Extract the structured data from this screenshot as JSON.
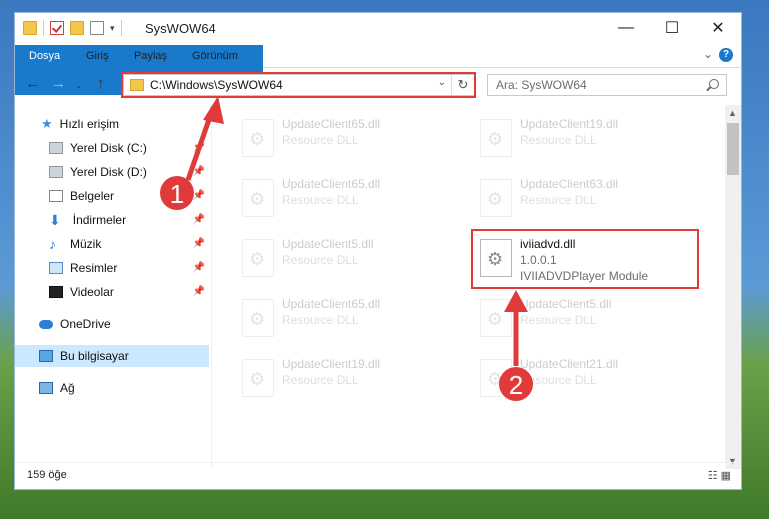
{
  "window": {
    "title": "SysWOW64",
    "controls": {
      "minimize": "—",
      "maximize": "☐",
      "close": "✕"
    }
  },
  "ribbon": {
    "tabs": [
      "Dosya",
      "Giriş",
      "Paylaş",
      "Görünüm"
    ],
    "help": "?"
  },
  "address_bar": {
    "path": "C:\\Windows\\SysWOW64",
    "refresh_glyph": "↻"
  },
  "search": {
    "placeholder": "Ara: SysWOW64"
  },
  "sidebar": {
    "items": [
      {
        "label": "Hızlı erişim",
        "icon": "star-icon"
      },
      {
        "label": "Yerel Disk (C:)",
        "icon": "disk-icon",
        "pinned": true
      },
      {
        "label": "Yerel Disk (D:)",
        "icon": "disk-icon",
        "pinned": true
      },
      {
        "label": "Belgeler",
        "icon": "document-icon",
        "pinned": true
      },
      {
        "label": "İndirmeler",
        "icon": "download-icon",
        "pinned": true
      },
      {
        "label": "Müzik",
        "icon": "music-icon",
        "pinned": true
      },
      {
        "label": "Resimler",
        "icon": "picture-icon",
        "pinned": true
      },
      {
        "label": "Videolar",
        "icon": "video-icon",
        "pinned": true
      },
      {
        "label": "OneDrive",
        "icon": "cloud-icon"
      },
      {
        "label": "Bu bilgisayar",
        "icon": "computer-icon",
        "selected": true
      },
      {
        "label": "Ağ",
        "icon": "network-icon"
      }
    ]
  },
  "files": [
    {
      "name": "UpdateClient65.dll",
      "type": "Resource DLL",
      "faded": true
    },
    {
      "name": "UpdateClient19.dll",
      "type": "Resource DLL",
      "faded": true
    },
    {
      "name": "UpdateClient65.dll",
      "type": "Resource DLL",
      "faded": true
    },
    {
      "name": "UpdateClient63.dll",
      "type": "Resource DLL",
      "faded": true
    },
    {
      "name": "UpdateClient5.dll",
      "type": "Resource DLL",
      "faded": true
    },
    {
      "name": "iviiadvd.dll",
      "version": "1.0.0.1",
      "type": "IVIIADVDPlayer Module",
      "faded": false
    },
    {
      "name": "UpdateClient65.dll",
      "type": "Resource DLL",
      "faded": true
    },
    {
      "name": "UpdateClient5.dll",
      "type": "Resource DLL",
      "faded": true
    },
    {
      "name": "UpdateClient19.dll",
      "type": "Resource DLL",
      "faded": true
    },
    {
      "name": "UpdateClient21.dll",
      "type": "Resource DLL",
      "faded": true
    }
  ],
  "status_bar": {
    "item_count": "159 öğe"
  },
  "annotations": {
    "step1": "1",
    "step2": "2",
    "color": "#e03a3a"
  }
}
